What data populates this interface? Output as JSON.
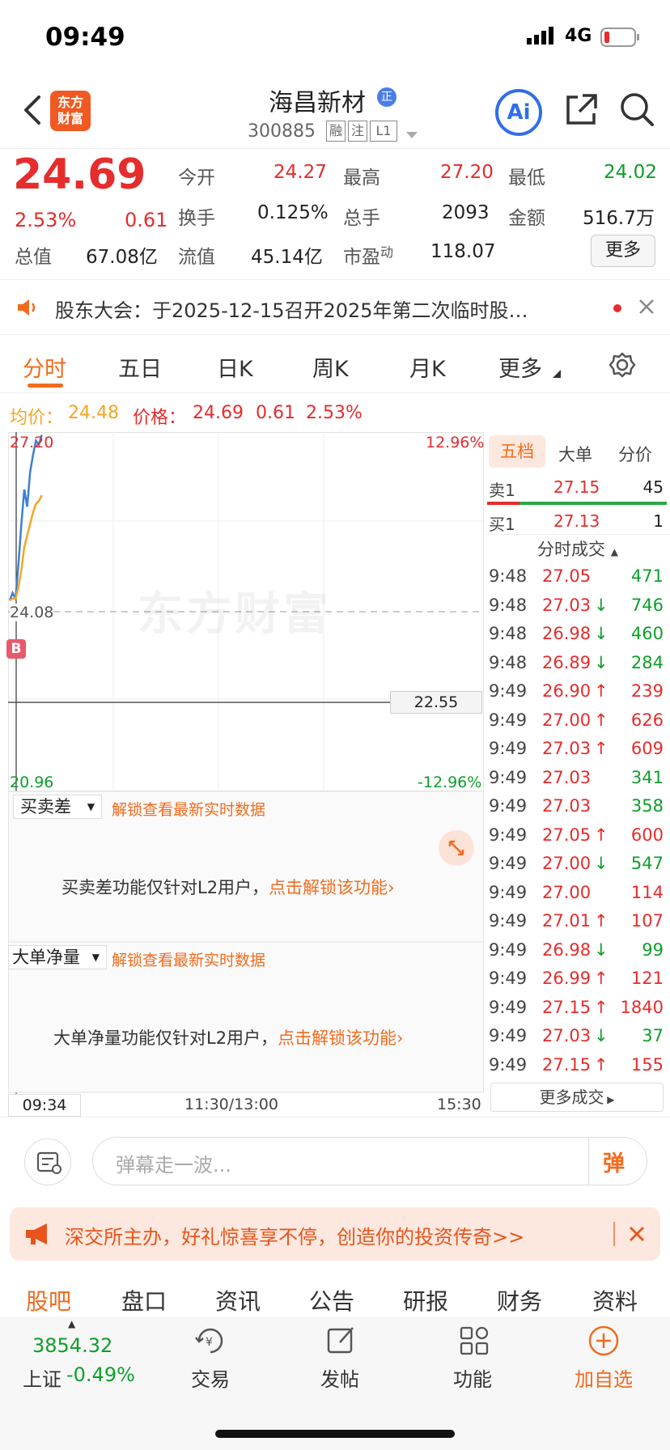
{
  "status": {
    "time": "09:49",
    "network": "4G"
  },
  "header": {
    "logo_text_top": "东方",
    "logo_text_bottom": "财富",
    "stock_name": "海昌新材",
    "stock_badge": "正",
    "stock_code": "300885",
    "tags": [
      "融",
      "注",
      "L1"
    ],
    "ai_label": "Ai"
  },
  "quote": {
    "price": "24.69",
    "change_pct": "2.53%",
    "change": "0.61",
    "fields": {
      "open_label": "今开",
      "open": "24.27",
      "high_label": "最高",
      "high": "27.20",
      "low_label": "最低",
      "low": "24.02",
      "turnover_label": "换手",
      "turnover": "0.125%",
      "volume_label": "总手",
      "volume": "2093",
      "amount_label": "金额",
      "amount": "516.7万",
      "mktcap_label": "总值",
      "mktcap": "67.08亿",
      "float_label": "流值",
      "float": "45.14亿",
      "pe_label": "市盈",
      "pe_sup": "动",
      "pe": "118.07"
    },
    "more_button": "更多"
  },
  "notice": {
    "text": "股东大会：于2025-12-15召开2025年第二次临时股…"
  },
  "tabs": {
    "items": [
      "分时",
      "五日",
      "日K",
      "周K",
      "月K",
      "更多"
    ],
    "active": "分时"
  },
  "chart_info": {
    "avg_label": "均价：",
    "avg": "24.48",
    "price_label": "价格：",
    "price": "24.69",
    "change": "0.61",
    "change_pct": "2.53%"
  },
  "chart": {
    "top_price": "27.20",
    "top_pct": "12.96%",
    "mid_price": "24.08",
    "bottom_price": "20.96",
    "bottom_pct": "-12.96%",
    "crosshair_value": "22.55",
    "marker": "B",
    "watermark": "东方财富",
    "time_start": "09:34",
    "time_mid": "11:30/13:00",
    "time_end": "15:30"
  },
  "chart_data": {
    "type": "line",
    "ylim": [
      20.96,
      27.2
    ],
    "series": [
      {
        "values": [
          24.27,
          24.4,
          24.3,
          24.9,
          25.6,
          26.2,
          25.9,
          26.5,
          26.8,
          27.05,
          26.98,
          27.15
        ]
      },
      {
        "values": [
          24.27,
          24.3,
          24.3,
          24.5,
          24.8,
          25.2,
          25.4,
          25.6,
          25.8,
          25.95,
          26.0,
          26.1
        ]
      }
    ]
  },
  "indicators": {
    "panel1": {
      "label": "买卖差",
      "unlock": "解锁查看最新实时数据",
      "msg": "买卖差功能仅针对L2用户，",
      "link": "点击解锁该功能"
    },
    "panel2": {
      "label": "大单净量",
      "unlock": "解锁查看最新实时数据",
      "msg": "大单净量功能仅针对L2用户，",
      "link": "点击解锁该功能"
    }
  },
  "right_panel": {
    "tabs": [
      "五档",
      "大单",
      "分价"
    ],
    "sell1": {
      "label": "卖1",
      "price": "27.15",
      "vol": "45"
    },
    "buy1": {
      "label": "买1",
      "price": "27.13",
      "vol": "1"
    },
    "trades_title": "分时成交",
    "trades": [
      {
        "time": "9:48",
        "price": "27.05",
        "arrow": "",
        "vol": "471",
        "dir": "green"
      },
      {
        "time": "9:48",
        "price": "27.03",
        "arrow": "↓",
        "vol": "746",
        "dir": "green"
      },
      {
        "time": "9:48",
        "price": "26.98",
        "arrow": "↓",
        "vol": "460",
        "dir": "green"
      },
      {
        "time": "9:48",
        "price": "26.89",
        "arrow": "↓",
        "vol": "284",
        "dir": "green"
      },
      {
        "time": "9:49",
        "price": "26.90",
        "arrow": "↑",
        "vol": "239",
        "dir": "red"
      },
      {
        "time": "9:49",
        "price": "27.00",
        "arrow": "↑",
        "vol": "626",
        "dir": "red"
      },
      {
        "time": "9:49",
        "price": "27.03",
        "arrow": "↑",
        "vol": "609",
        "dir": "red"
      },
      {
        "time": "9:49",
        "price": "27.03",
        "arrow": "",
        "vol": "341",
        "dir": "green"
      },
      {
        "time": "9:49",
        "price": "27.03",
        "arrow": "",
        "vol": "358",
        "dir": "green"
      },
      {
        "time": "9:49",
        "price": "27.05",
        "arrow": "↑",
        "vol": "600",
        "dir": "red"
      },
      {
        "time": "9:49",
        "price": "27.00",
        "arrow": "↓",
        "vol": "547",
        "dir": "green"
      },
      {
        "time": "9:49",
        "price": "27.00",
        "arrow": "",
        "vol": "114",
        "dir": "red"
      },
      {
        "time": "9:49",
        "price": "27.01",
        "arrow": "↑",
        "vol": "107",
        "dir": "red"
      },
      {
        "time": "9:49",
        "price": "26.98",
        "arrow": "↓",
        "vol": "99",
        "dir": "green"
      },
      {
        "time": "9:49",
        "price": "26.99",
        "arrow": "↑",
        "vol": "121",
        "dir": "red"
      },
      {
        "time": "9:49",
        "price": "27.15",
        "arrow": "↑",
        "vol": "1840",
        "dir": "red"
      },
      {
        "time": "9:49",
        "price": "27.03",
        "arrow": "↓",
        "vol": "37",
        "dir": "green"
      },
      {
        "time": "9:49",
        "price": "27.15",
        "arrow": "↑",
        "vol": "155",
        "dir": "red"
      }
    ],
    "more_trades": "更多成交"
  },
  "comment": {
    "placeholder": "弹幕走一波...",
    "danmu": "弹"
  },
  "banner": {
    "text": "深交所主办，好礼惊喜享不停，创造你的投资传奇>>"
  },
  "bottom_tabs": [
    "股吧",
    "盘口",
    "资讯",
    "公告",
    "研报",
    "财务",
    "资料"
  ],
  "dock": {
    "index_value": "3854.32",
    "index_name": "上证",
    "index_change": "-0.49%",
    "items": [
      "交易",
      "发帖",
      "功能",
      "加自选"
    ]
  }
}
